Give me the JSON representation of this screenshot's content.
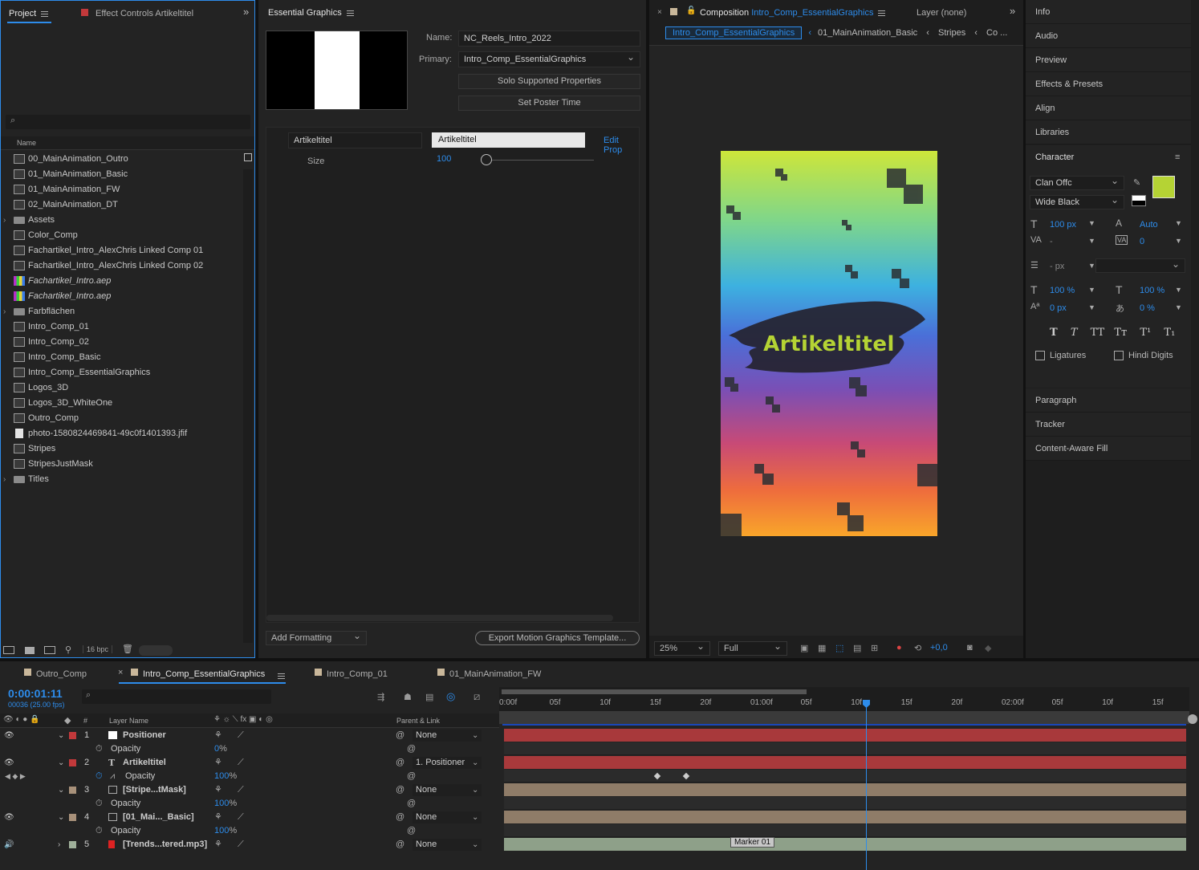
{
  "project_panel": {
    "tab_project": "Project",
    "tab_effect": "Effect Controls Artikeltitel",
    "column_name": "Name",
    "bpc": "16 bpc",
    "items": [
      {
        "name": "00_MainAnimation_Outro",
        "type": "comp"
      },
      {
        "name": "01_MainAnimation_Basic",
        "type": "comp"
      },
      {
        "name": "01_MainAnimation_FW",
        "type": "comp"
      },
      {
        "name": "02_MainAnimation_DT",
        "type": "comp"
      },
      {
        "name": "Assets",
        "type": "folder"
      },
      {
        "name": "Color_Comp",
        "type": "comp"
      },
      {
        "name": "Fachartikel_Intro_AlexChris Linked Comp 01",
        "type": "comp"
      },
      {
        "name": "Fachartikel_Intro_AlexChris Linked Comp 02",
        "type": "comp"
      },
      {
        "name": "Fachartikel_Intro.aep",
        "type": "aep"
      },
      {
        "name": "Fachartikel_Intro.aep",
        "type": "aep"
      },
      {
        "name": "Farbflächen",
        "type": "folder"
      },
      {
        "name": "Intro_Comp_01",
        "type": "comp"
      },
      {
        "name": "Intro_Comp_02",
        "type": "comp"
      },
      {
        "name": "Intro_Comp_Basic",
        "type": "comp"
      },
      {
        "name": "Intro_Comp_EssentialGraphics",
        "type": "comp"
      },
      {
        "name": "Logos_3D",
        "type": "comp"
      },
      {
        "name": "Logos_3D_WhiteOne",
        "type": "comp"
      },
      {
        "name": "Outro_Comp",
        "type": "comp"
      },
      {
        "name": "photo-1580824469841-49c0f1401393.jfif",
        "type": "file"
      },
      {
        "name": "Stripes",
        "type": "comp"
      },
      {
        "name": "StripesJustMask",
        "type": "comp"
      },
      {
        "name": "Titles",
        "type": "folder"
      }
    ]
  },
  "essential_graphics": {
    "tab": "Essential Graphics",
    "name_label": "Name:",
    "name_value": "NC_Reels_Intro_2022",
    "primary_label": "Primary:",
    "primary_value": "Intro_Comp_EssentialGraphics",
    "solo_btn": "Solo Supported Properties",
    "poster_btn": "Set Poster Time",
    "prop_name": "Artikeltitel",
    "prop_value": "Artikeltitel",
    "edit_prop": "Edit Prop",
    "size_label": "Size",
    "size_value": "100",
    "add_formatting": "Add Formatting",
    "export_btn": "Export Motion Graphics Template..."
  },
  "composition": {
    "tab_prefix": "Composition",
    "tab_comp": "Intro_Comp_EssentialGraphics",
    "layer_tab": "Layer (none)",
    "breadcrumbs": [
      "Intro_Comp_EssentialGraphics",
      "01_MainAnimation_Basic",
      "Stripes",
      "Co ..."
    ],
    "title_text": "Artikeltitel",
    "zoom": "25%",
    "resolution": "Full",
    "exposure": "+0,0"
  },
  "right_panels": {
    "top": [
      "Info",
      "Audio",
      "Preview",
      "Effects & Presets",
      "Align",
      "Libraries"
    ],
    "character": "Character",
    "font": "Clan Offc",
    "style": "Wide Black",
    "font_size": "100 px",
    "leading": "Auto",
    "kerning": "-",
    "tracking": "0",
    "stroke": "- px",
    "vscale": "100 %",
    "hscale": "100 %",
    "baseline": "0 px",
    "tsume": "0 %",
    "ligatures": "Ligatures",
    "hindi": "Hindi Digits",
    "bottom": [
      "Paragraph",
      "Tracker",
      "Content-Aware Fill"
    ],
    "fill_color": "#b5d334"
  },
  "timeline": {
    "tabs": [
      "Outro_Comp",
      "Intro_Comp_EssentialGraphics",
      "Intro_Comp_01",
      "01_MainAnimation_FW"
    ],
    "timecode": "0:00:01:11",
    "frame_info": "00036 (25.00 fps)",
    "col_layer": "Layer Name",
    "col_parent": "Parent & Link",
    "ruler": [
      "0:00f",
      "05f",
      "10f",
      "15f",
      "20f",
      "01:00f",
      "05f",
      "10f",
      "15f",
      "20f",
      "02:00f",
      "05f",
      "10f",
      "15f"
    ],
    "layers": [
      {
        "num": "1",
        "name": "Positioner",
        "parent": "None",
        "color": "#c2393b",
        "prop": "Opacity",
        "prop_value": "0",
        "unit": "%"
      },
      {
        "num": "2",
        "name": "Artikeltitel",
        "parent": "1. Positioner",
        "color": "#c2393b",
        "prop": "Opacity",
        "prop_value": "100",
        "unit": "%"
      },
      {
        "num": "3",
        "name": "[Stripe...tMask]",
        "parent": "None",
        "color": "#a8917a",
        "prop": "Opacity",
        "prop_value": "100",
        "unit": "%"
      },
      {
        "num": "4",
        "name": "[01_Mai..._Basic]",
        "parent": "None",
        "color": "#a8917a",
        "prop": "Opacity",
        "prop_value": "100",
        "unit": "%"
      },
      {
        "num": "5",
        "name": "[Trends...tered.mp3]",
        "parent": "None",
        "color": "#9fb09a"
      }
    ],
    "marker": "Marker 01"
  }
}
